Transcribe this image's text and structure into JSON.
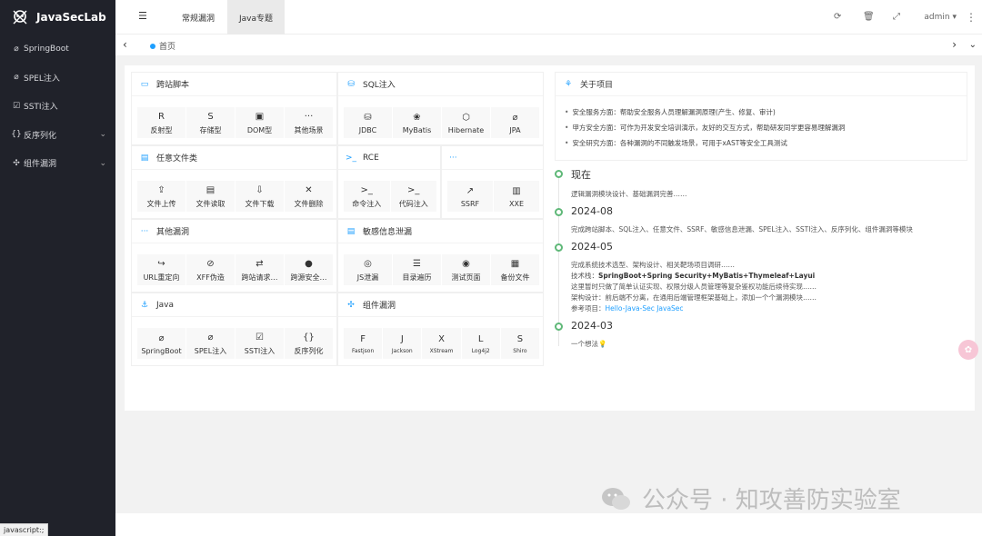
{
  "app": {
    "title": "JavaSecLab"
  },
  "sidebar": {
    "items": [
      {
        "icon": "leaf-icon",
        "label": "SpringBoot",
        "has_arrow": false
      },
      {
        "icon": "leaf-icon",
        "label": "SPEL注入",
        "has_arrow": false
      },
      {
        "icon": "checkbox-icon",
        "label": "SSTI注入",
        "has_arrow": false
      },
      {
        "icon": "json-icon",
        "label": "反序列化",
        "has_arrow": true
      },
      {
        "icon": "puzzle-icon",
        "label": "组件漏洞",
        "has_arrow": true
      }
    ],
    "status": "javascript:;"
  },
  "header": {
    "tabs": [
      {
        "label": "常规漏洞",
        "active": false
      },
      {
        "label": "Java专题",
        "active": true
      }
    ],
    "user": "admin"
  },
  "tabsbar": {
    "home": "首页"
  },
  "panels": [
    {
      "key": "xss",
      "title": "跨站脚本",
      "buttons": [
        {
          "icon": "R",
          "label": "反射型"
        },
        {
          "icon": "S",
          "label": "存储型"
        },
        {
          "icon": "▣",
          "label": "DOM型"
        },
        {
          "icon": "···",
          "label": "其他场景"
        }
      ]
    },
    {
      "key": "sqli",
      "title": "SQL注入",
      "buttons": [
        {
          "icon": "⛁",
          "label": "JDBC"
        },
        {
          "icon": "❀",
          "label": "MyBatis"
        },
        {
          "icon": "⬡",
          "label": "Hibernate"
        },
        {
          "icon": "⌀",
          "label": "JPA"
        }
      ]
    },
    {
      "key": "file",
      "title": "任意文件类",
      "buttons": [
        {
          "icon": "⇪",
          "label": "文件上传"
        },
        {
          "icon": "▤",
          "label": "文件读取"
        },
        {
          "icon": "⇩",
          "label": "文件下载"
        },
        {
          "icon": "✕",
          "label": "文件删除"
        }
      ]
    },
    {
      "key": "rce",
      "title": "RCE",
      "buttons": [
        {
          "icon": ">_",
          "label": "命令注入"
        },
        {
          "icon": ">_",
          "label": "代码注入"
        }
      ]
    },
    {
      "key": "ssrf",
      "title": "···",
      "buttons": [
        {
          "icon": "↗",
          "label": "SSRF"
        },
        {
          "icon": "▥",
          "label": "XXE"
        }
      ]
    },
    {
      "key": "other",
      "title": "其他漏洞",
      "buttons": [
        {
          "icon": "↪",
          "label": "URL重定向"
        },
        {
          "icon": "⊘",
          "label": "XFF伪造"
        },
        {
          "icon": "⇄",
          "label": "跨站请求…"
        },
        {
          "icon": "●",
          "label": "跨源安全…"
        }
      ]
    },
    {
      "key": "leak",
      "title": "敏感信息泄漏",
      "buttons": [
        {
          "icon": "◎",
          "label": "JS泄漏"
        },
        {
          "icon": "☰",
          "label": "目录遍历"
        },
        {
          "icon": "◉",
          "label": "测试页面"
        },
        {
          "icon": "▦",
          "label": "备份文件"
        }
      ]
    },
    {
      "key": "java",
      "title": "Java",
      "buttons": [
        {
          "icon": "⌀",
          "label": "SpringBoot"
        },
        {
          "icon": "⌀",
          "label": "SPEL注入"
        },
        {
          "icon": "☑",
          "label": "SSTI注入"
        },
        {
          "icon": "{}",
          "label": "反序列化"
        }
      ]
    },
    {
      "key": "comp",
      "title": "组件漏洞",
      "buttons": [
        {
          "icon": "F",
          "label": "Fastjson"
        },
        {
          "icon": "J",
          "label": "Jackson"
        },
        {
          "icon": "X",
          "label": "XStream"
        },
        {
          "icon": "L",
          "label": "Log4j2"
        },
        {
          "icon": "S",
          "label": "Shiro"
        }
      ]
    }
  ],
  "about": {
    "title": "关于项目",
    "items": [
      "安全服务方面：帮助安全服务人员理解漏洞原理(产生、修复、审计)",
      "甲方安全方面：可作为开发安全培训演示，友好的交互方式，帮助研发同学更容易理解漏洞",
      "安全研究方面：各种漏洞的不同触发场景，可用于xAST等安全工具测试"
    ]
  },
  "timeline": [
    {
      "title": "现在",
      "lines": [
        "逻辑漏洞模块设计、基础漏洞完善……"
      ]
    },
    {
      "title": "2024-08",
      "lines": [
        "完成跨站脚本、SQL注入、任意文件、SSRF、敏感信息泄漏、SPEL注入、SSTI注入、反序列化、组件漏洞等模块"
      ]
    },
    {
      "title": "2024-05",
      "lines": [
        "完成系统技术选型、架构设计、相关靶场项目调研……",
        "技术栈：",
        "SpringBoot+Spring Security+MyBatis+Thymeleaf+Layui",
        "这里暂时只做了简单认证实现、权限分级人员管理等复杂鉴权功能后续待实现……",
        "架构设计：前后端不分离，在通用后端管理框架基础上，添加一个个漏洞模块……",
        "参考项目：",
        "Hello-Java-Sec JavaSec"
      ]
    },
    {
      "title": "2024-03",
      "lines": [
        "一个想法💡"
      ]
    }
  ],
  "watermark": "公众号 · 知攻善防实验室"
}
